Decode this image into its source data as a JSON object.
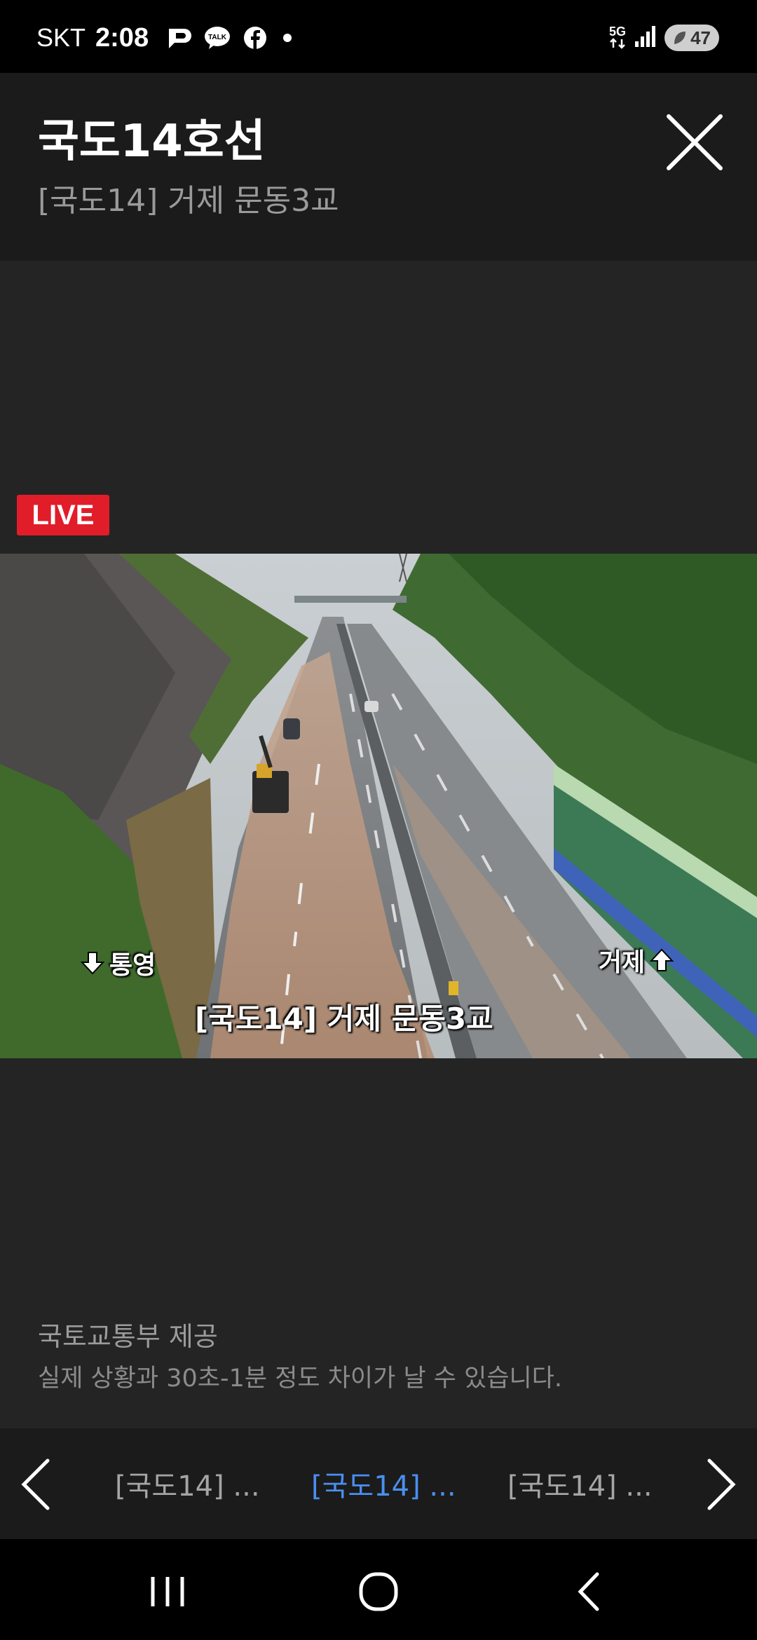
{
  "status_bar": {
    "carrier": "SKT",
    "time": "2:08",
    "notification_icons": [
      "pay-icon",
      "kakaotalk-icon",
      "facebook-icon",
      "more-dot-icon"
    ],
    "talk_label": "TALK",
    "network_label": "5G",
    "battery_level": "47"
  },
  "header": {
    "title": "국도14호선",
    "subtitle": "[국도14] 거제 문동3교"
  },
  "player": {
    "live_label": "LIVE",
    "caption": "[국도14] 거제 문동3교",
    "direction_left": "통영",
    "direction_right": "거제"
  },
  "footer_info": {
    "provider": "국토교통부 제공",
    "disclaimer": "실제 상황과 30초-1분 정도 차이가 날 수 있습니다."
  },
  "carousel": {
    "items": [
      {
        "label": "[국도14] ..."
      },
      {
        "label": "[국도14] ..."
      },
      {
        "label": "[국도14] ..."
      }
    ],
    "active_index": 1
  },
  "colors": {
    "live_red": "#e11d2a",
    "active_blue": "#4a8ff0",
    "header_bg": "#1b1b1b",
    "main_bg": "#242424"
  }
}
